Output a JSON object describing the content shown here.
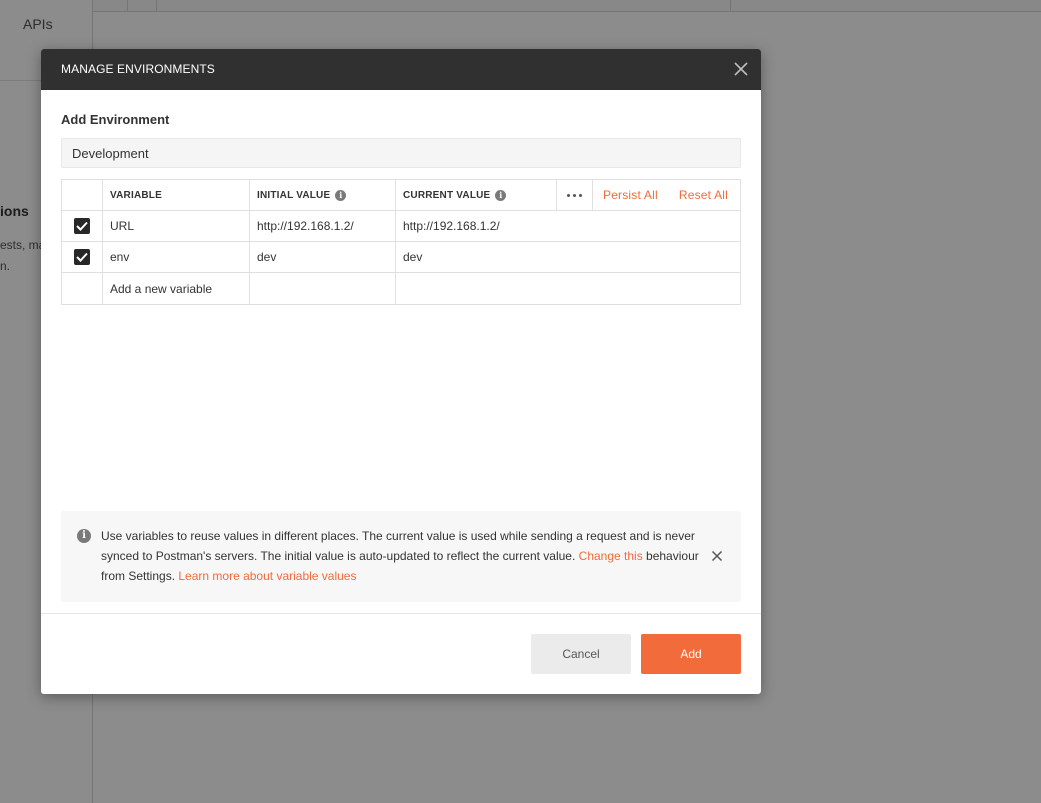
{
  "background": {
    "sidebar_item": "APIs",
    "heading_fragment": "ions",
    "text_fragment_1": "ests, ma",
    "text_fragment_2": "n."
  },
  "modal": {
    "title": "MANAGE ENVIRONMENTS",
    "section_label": "Add Environment",
    "environment_name": "Development",
    "table": {
      "headers": {
        "variable": "VARIABLE",
        "initial_value": "INITIAL VALUE",
        "current_value": "CURRENT VALUE"
      },
      "actions": {
        "persist_all": "Persist All",
        "reset_all": "Reset All"
      },
      "rows": [
        {
          "checked": true,
          "variable": "URL",
          "initial": "http://192.168.1.2/",
          "current": "http://192.168.1.2/"
        },
        {
          "checked": true,
          "variable": "env",
          "initial": "dev",
          "current": "dev"
        }
      ],
      "new_variable_placeholder": "Add a new variable"
    },
    "info": {
      "text_part1": "Use variables to reuse values in different places. The current value is used while sending a request and is never synced to Postman's servers. The initial value is auto-updated to reflect the current value. ",
      "link_change": "Change this",
      "text_part2": " behaviour from Settings. ",
      "link_learn": "Learn more about variable values"
    },
    "buttons": {
      "cancel": "Cancel",
      "add": "Add"
    }
  },
  "colors": {
    "accent": "#f26b3a",
    "header_bg": "#303030",
    "checkbox": "#282828"
  },
  "icons": {
    "close": "close-icon",
    "info": "info-icon",
    "more": "more-horizontal-icon",
    "check": "check-icon"
  }
}
